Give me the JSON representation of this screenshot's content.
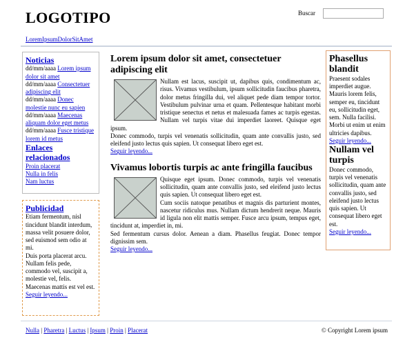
{
  "header": {
    "logo": "LOGOTIPO",
    "search_label": "Buscar",
    "search_value": "",
    "site_link": "LoremIpsumDolorSitAmet"
  },
  "sidebar": {
    "news": {
      "title": "Noticias",
      "items": [
        {
          "date": "dd/mm/aaaa",
          "link": "Lorem ipsum dolor sit amet"
        },
        {
          "date": "dd/mm/aaaa",
          "link": "Consectetuer adipiscing elit"
        },
        {
          "date": "dd/mm/aaaa",
          "link": "Donec molestie nunc eu sapien"
        },
        {
          "date": "dd/mm/aaaa",
          "link": "Maecenas aliquam dolor eget metus"
        },
        {
          "date": "dd/mm/aaaa",
          "link": "Fusce tristique lorem id metus"
        }
      ]
    },
    "related": {
      "title": "Enlaces relacionados",
      "items": [
        "Proin placerat",
        "Nulla in felis",
        "Nam luctus"
      ]
    },
    "ad": {
      "title": "Publicidad",
      "text1": "Etiam fermentum, nisl tincidunt blandit interdum, massa velit posuere dolor, sed euismod sem odio at mi.",
      "text2": "Duis porta placerat arcu. Nullam felis pede, commodo vel, suscipit a, molestie vel, felis. Maecenas mattis est vel est.",
      "more": "Seguir leyendo..."
    }
  },
  "main": {
    "articles": [
      {
        "title": "Lorem ipsum dolor sit amet, consectetuer adipiscing elit",
        "p1": "Nullam est lacus, suscipit ut, dapibus quis, condimentum ac, risus. Vivamus vestibulum, ipsum sollicitudin faucibus pharetra, dolor metus fringilla dui, vel aliquet pede diam tempor tortor. Vestibulum pulvinar urna et quam. Pellentesque habitant morbi tristique senectus et netus et malesuada fames ac turpis egestas. Nullam vel turpis vitae dui imperdiet laoreet. Quisque eget ipsum.",
        "p2": "Donec commodo, turpis vel venenatis sollicitudin, quam ante convallis justo, sed eleifend justo lectus quis sapien. Ut consequat libero eget est.",
        "more": "Seguir leyendo..."
      },
      {
        "title": "Vivamus lobortis turpis ac ante fringilla faucibus",
        "p1": "Quisque eget ipsum. Donec commodo, turpis vel venenatis sollicitudin, quam ante convallis justo, sed eleifend justo lectus quis sapien. Ut consequat libero eget est.",
        "p2": "Cum sociis natoque penatibus et magnis dis parturient montes, nascetur ridiculus mus. Nullam dictum hendrerit neque. Mauris id ligula non elit mattis semper. Fusce arcu ipsum, tempus eget, tincidunt at, imperdiet in, mi.",
        "p3": "Sed fermentum cursus dolor. Aenean a diam. Phasellus feugiat. Donec tempor dignissim sem.",
        "more": "Seguir leyendo..."
      }
    ]
  },
  "right": {
    "title1": "Phasellus blandit",
    "text1": "Praesent sodales imperdiet augue. Mauris lorem felis, semper eu, tincidunt eu, sollicitudin eget, sem. Nulla facilisi. Morbi ut enim ut enim ultricies dapibus.",
    "more1": "Seguir leyendo...",
    "title2": "Nullam vel turpis",
    "text2": "Donec commodo, turpis vel venenatis sollicitudin, quam ante convallis justo, sed eleifend justo lectus quis sapien. Ut consequat libero eget est.",
    "more2": "Seguir leyendo..."
  },
  "footer": {
    "links": [
      "Nulla",
      "Pharetra",
      "Luctus",
      "Ipsum",
      "Proin",
      "Placerat"
    ],
    "separator": " | ",
    "copyright": "© Copyright Lorem ipsum"
  },
  "icons": {
    "thumb": "image-placeholder-icon"
  }
}
